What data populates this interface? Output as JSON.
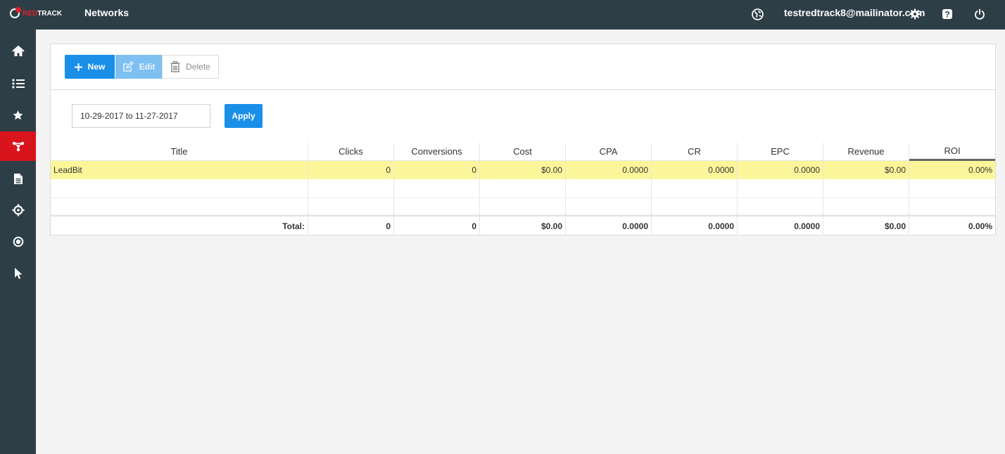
{
  "app": {
    "logo_red": "RED",
    "logo_white": "TRACK"
  },
  "header": {
    "title": "Networks",
    "user_email": "testredtrack8@mailinator.com",
    "icons": [
      "globe-icon",
      "gear-icon",
      "help-icon",
      "power-icon"
    ]
  },
  "sidebar": {
    "items": [
      {
        "name": "home",
        "icon": "home-icon",
        "active": false
      },
      {
        "name": "campaigns",
        "icon": "list-icon",
        "active": false
      },
      {
        "name": "offers",
        "icon": "star-icon",
        "active": false
      },
      {
        "name": "networks",
        "icon": "network-icon",
        "active": true
      },
      {
        "name": "reports",
        "icon": "document-icon",
        "active": false
      },
      {
        "name": "tracking",
        "icon": "crosshair-icon",
        "active": false
      },
      {
        "name": "sources",
        "icon": "target-icon",
        "active": false
      },
      {
        "name": "clicks",
        "icon": "cursor-icon",
        "active": false
      }
    ]
  },
  "toolbar": {
    "new_label": "New",
    "edit_label": "Edit",
    "delete_label": "Delete"
  },
  "filter": {
    "date_range": "10-29-2017 to 11-27-2017",
    "apply_label": "Apply"
  },
  "table": {
    "columns": [
      "Title",
      "Clicks",
      "Conversions",
      "Cost",
      "CPA",
      "CR",
      "EPC",
      "Revenue",
      "ROI"
    ],
    "sorted_column": "ROI",
    "rows": [
      {
        "title": "LeadBit",
        "clicks": "0",
        "conversions": "0",
        "cost": "$0.00",
        "cpa": "0.0000",
        "cr": "0.0000",
        "epc": "0.0000",
        "revenue": "$0.00",
        "roi": "0.00%"
      }
    ],
    "totals": {
      "label": "Total:",
      "clicks": "0",
      "conversions": "0",
      "cost": "$0.00",
      "cpa": "0.0000",
      "cr": "0.0000",
      "epc": "0.0000",
      "revenue": "$0.00",
      "roi": "0.00%"
    }
  },
  "colors": {
    "topbar": "#2e3e47",
    "accent": "#1a8fe8",
    "active_nav": "#d9141c",
    "selected_row": "#fcf69a"
  }
}
